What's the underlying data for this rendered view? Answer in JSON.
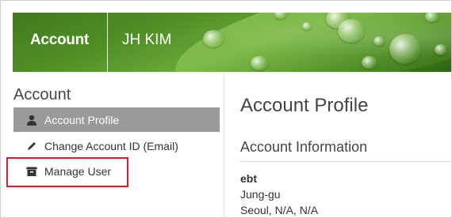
{
  "header": {
    "tabs": [
      {
        "label": "Account"
      },
      {
        "label": "JH KIM"
      }
    ]
  },
  "sidebar": {
    "title": "Account",
    "items": [
      {
        "label": "Account Profile",
        "icon": "person-icon",
        "active": true
      },
      {
        "label": "Change Account ID (Email)",
        "icon": "pencil-icon",
        "active": false
      },
      {
        "label": "Manage User",
        "icon": "archive-box-icon",
        "active": false
      }
    ]
  },
  "main": {
    "title": "Account Profile",
    "section_title": "Account Information",
    "address": {
      "name": "ebt",
      "line1": "Jung-gu",
      "line2": "Seoul, N/A, N/A"
    }
  },
  "colors": {
    "active_item_bg": "#9a9a9a",
    "highlight_border": "#d41f2c",
    "header_green": "#4f8f25"
  }
}
